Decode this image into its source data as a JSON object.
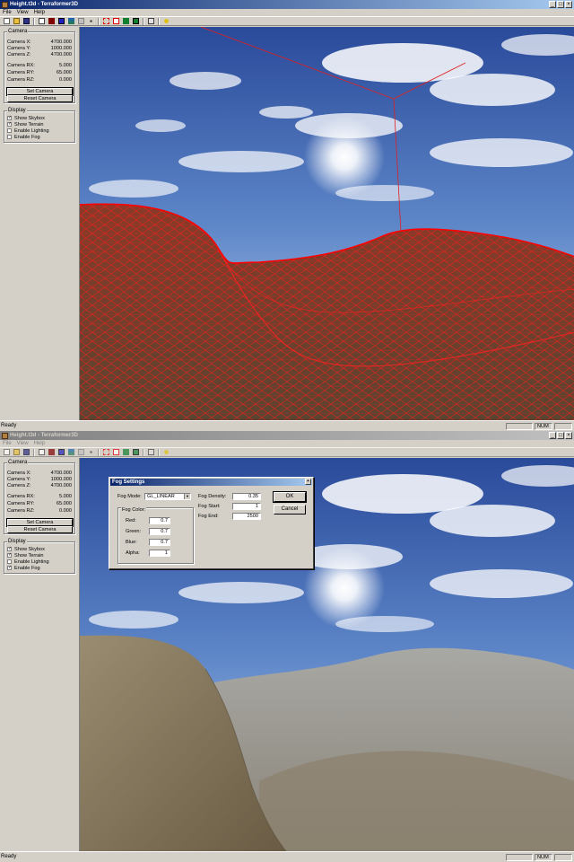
{
  "app_title": "Height.t3d - Terraformer3D",
  "window_buttons": [
    "_",
    "□",
    "×"
  ],
  "menu": [
    "File",
    "View",
    "Help"
  ],
  "toolbar_icons": [
    "new-file-icon",
    "open-folder-icon",
    "save-icon",
    "separator",
    "fit-view-icon",
    "solid-terrain-icon",
    "wireframe-icon",
    "textured-icon",
    "flat-icon",
    "points-icon",
    "separator",
    "red-grid-icon",
    "red-box-icon",
    "green-terrain-icon",
    "green-box-icon",
    "separator",
    "export-icon",
    "separator",
    "help-icon"
  ],
  "camera_group": {
    "title": "Camera",
    "rows": [
      {
        "label": "Camera X:",
        "value": "4700.000"
      },
      {
        "label": "Camera Y:",
        "value": "1000.000"
      },
      {
        "label": "Camera Z:",
        "value": "4700.000"
      },
      {
        "label": "Camera RX:",
        "value": "5.000"
      },
      {
        "label": "Camera RY:",
        "value": "65.000"
      },
      {
        "label": "Camera RZ:",
        "value": "0.000"
      }
    ],
    "set_button": "Set Camera",
    "reset_button": "Reset Camera"
  },
  "display_group": {
    "title": "Display",
    "skybox": "Show Skybox",
    "terrain": "Show Terrain",
    "lighting": "Enable Lighting",
    "fog": "Enable Fog"
  },
  "window1": {
    "show_skybox": true,
    "show_terrain": true,
    "enable_lighting": false,
    "enable_fog": false
  },
  "window2": {
    "show_skybox": true,
    "show_terrain": true,
    "enable_lighting": false,
    "enable_fog": true
  },
  "status": {
    "ready": "Ready",
    "num": "NUM"
  },
  "fog_dialog": {
    "title": "Fog Settings",
    "close": "×",
    "mode_label": "Fog Mode:",
    "mode_value": "GL_LINEAR",
    "color_group": "Fog Color:",
    "red_label": "Red:",
    "red": "0.7",
    "green_label": "Green:",
    "green": "0.7",
    "blue_label": "Blue:",
    "blue": "0.7",
    "alpha_label": "Alpha:",
    "alpha": "1",
    "density_label": "Fog Density:",
    "density": "0.35",
    "start_label": "Fog Start:",
    "start": "1",
    "end_label": "Fog End:",
    "end": "2500",
    "ok": "OK",
    "cancel": "Cancel"
  },
  "colors": {
    "titlebar": "#0a246a",
    "titlebar_end": "#a6caf0",
    "face": "#d4d0c8",
    "wire": "#ff0000",
    "sky": "#4a70b8"
  }
}
